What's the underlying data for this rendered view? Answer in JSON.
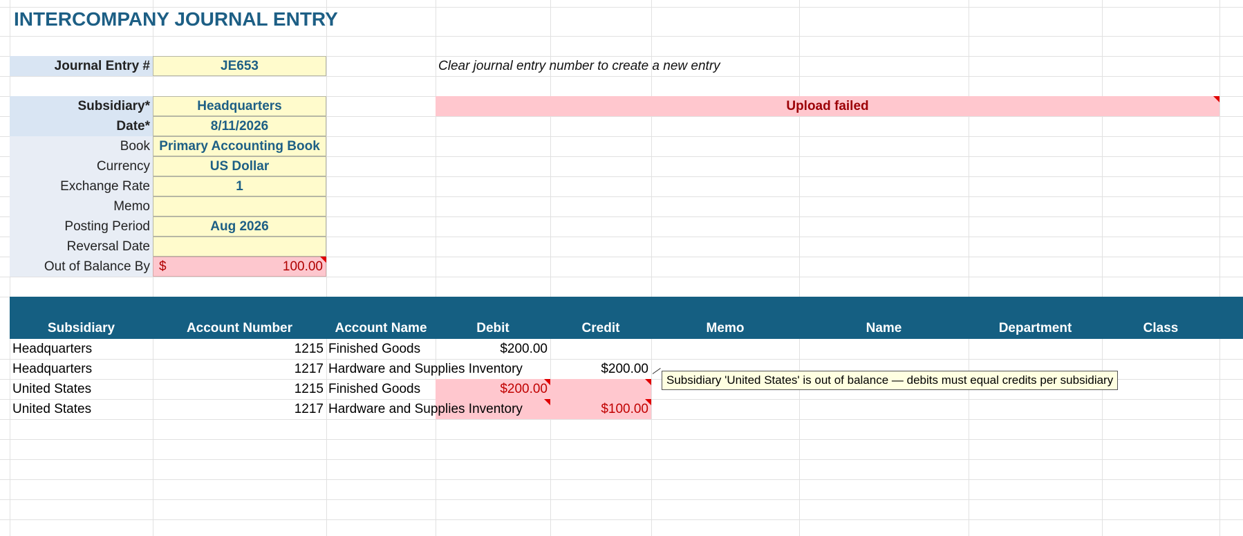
{
  "sheet": {
    "title": "INTERCOMPANY JOURNAL ENTRY",
    "hint": "Clear journal entry number to create a new entry",
    "upload_status": "Upload failed"
  },
  "header_fields": {
    "journal_entry": {
      "label": "Journal Entry #",
      "value": "JE653"
    },
    "subsidiary": {
      "label": "Subsidiary*",
      "value": "Headquarters"
    },
    "date": {
      "label": "Date*",
      "value": "8/11/2026"
    },
    "book": {
      "label": "Book",
      "value": "Primary Accounting Book"
    },
    "currency": {
      "label": "Currency",
      "value": "US Dollar"
    },
    "exchange_rate": {
      "label": "Exchange Rate",
      "value": "1"
    },
    "memo": {
      "label": "Memo",
      "value": ""
    },
    "posting_period": {
      "label": "Posting Period",
      "value": "Aug 2026"
    },
    "reversal_date": {
      "label": "Reversal Date",
      "value": ""
    },
    "out_of_balance": {
      "label": "Out of Balance By",
      "currency_symbol": "$",
      "value": "100.00"
    }
  },
  "lines_table": {
    "columns": [
      "Subsidiary",
      "Account Number",
      "Account Name",
      "Debit",
      "Credit",
      "Memo",
      "Name",
      "Department",
      "Class"
    ],
    "rows": [
      {
        "subsidiary": "Headquarters",
        "account_number": "1215",
        "account_name": "Finished Goods",
        "debit": "$200.00",
        "credit": ""
      },
      {
        "subsidiary": "Headquarters",
        "account_number": "1217",
        "account_name": "Hardware and Supplies Inventory",
        "debit": "",
        "credit": "$200.00"
      },
      {
        "subsidiary": "United States",
        "account_number": "1215",
        "account_name": "Finished Goods",
        "debit": "$200.00",
        "credit": ""
      },
      {
        "subsidiary": "United States",
        "account_number": "1217",
        "account_name": "Hardware and Supplies Inventory",
        "debit": "",
        "credit": "$100.00"
      }
    ]
  },
  "tooltip": {
    "text": "Subsidiary 'United States' is out of balance — debits must equal credits per subsidiary"
  },
  "colors": {
    "accent": "#1d5f85",
    "header_band": "#155f82",
    "input_fill": "#fffbcc",
    "error_fill": "#ffc7ce",
    "error_text": "#9c0006"
  }
}
